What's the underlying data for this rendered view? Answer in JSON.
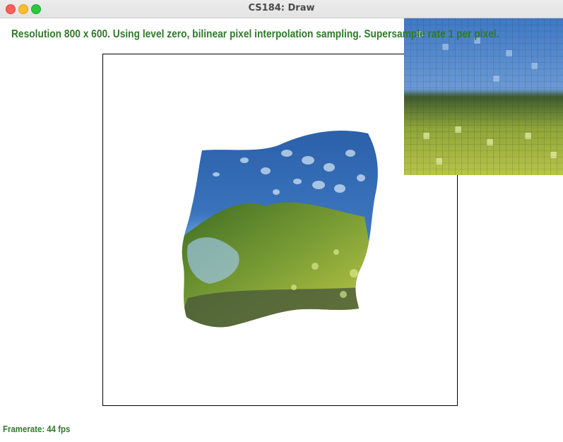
{
  "window": {
    "title": "CS184: Draw"
  },
  "status": {
    "text": "Resolution 800 x 600. Using level zero, bilinear pixel interpolation sampling. Supersample rate 1 per pixel."
  },
  "footer": {
    "framerate": "Framerate: 44 fps"
  },
  "colors": {
    "status_text": "#2f7a2a",
    "sky": "#3f7fc8",
    "foliage": "#7f9a2c"
  },
  "zoom": {
    "grid_columns": 25,
    "grid_rows": 25
  }
}
